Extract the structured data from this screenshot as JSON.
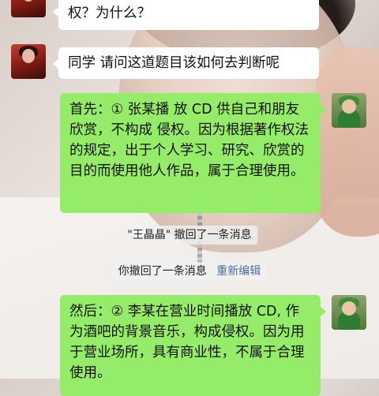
{
  "messages": {
    "top_received": "权？为什么？",
    "student_question": "同学 请问这道题目该如何去判断呢",
    "reply_first": "首先：① 张某播 放 CD 供自己和朋友欣赏，不构成 侵权。因为根据著作权法的规定，出于个人学习、研究、欣赏的目的而使用他人作品，属于合理使用。",
    "reply_second": "然后：② 李某在营业时间播放 CD, 作为酒吧的背景音乐，构成侵权。因为用于营业场所，具有商业性，不属于合理使用。"
  },
  "system_notices": {
    "recalled_by_other": "\"王晶晶\" 撤回了一条消息",
    "recalled_by_self": "你撤回了一条消息",
    "re_edit_link": "重新编辑"
  },
  "colors": {
    "bubble_sent": "#95ec69",
    "bubble_received": "#ffffff",
    "link": "#4a6ea8"
  }
}
